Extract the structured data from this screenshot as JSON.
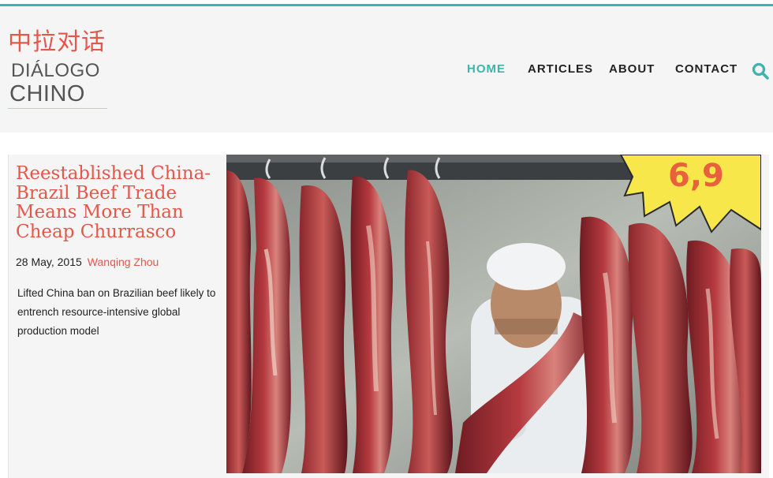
{
  "brand": {
    "logo_chinese": "中拉对话",
    "logo_line1": "DIÁLOGO",
    "logo_line2": "CHINO"
  },
  "nav": {
    "items": [
      {
        "label": "HOME",
        "active": true
      },
      {
        "label": "ARTICLES",
        "active": false
      },
      {
        "label": "ABOUT",
        "active": false
      },
      {
        "label": "CONTACT",
        "active": false
      }
    ],
    "search_icon": "search-icon"
  },
  "article": {
    "title": "Reestablished China-Brazil Beef Trade Means More Than Cheap Churrasco",
    "date": "28 May, 2015",
    "author": "Wanqing Zhou",
    "summary": "Lifted China ban on Brazilian beef likely to entrench resource-intensive global production model",
    "image_alt": "butcher-with-hanging-beef-photo"
  },
  "colors": {
    "accent": "#3fb3ac",
    "brand_red": "#e5574a",
    "nav_text": "#222222",
    "header_bg": "#f5f5f5"
  }
}
